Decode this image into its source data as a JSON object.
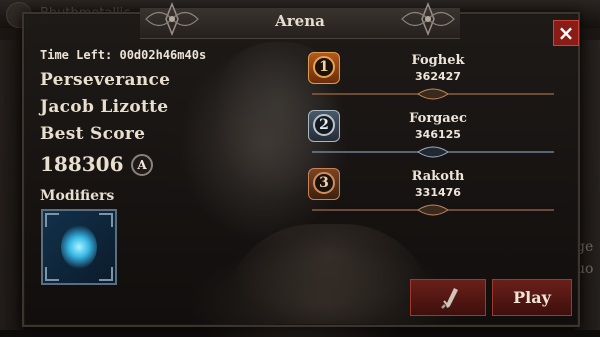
{
  "background": {
    "player_name": "Bhuthmetallic",
    "side_text": "ge\nuo"
  },
  "window": {
    "title": "Arena",
    "close_icon": "×"
  },
  "info": {
    "time_left": "Time Left: 00d02h46m40s",
    "mode": "Perseverance",
    "author": "Jacob Lizotte",
    "best_score_label": "Best Score",
    "best_score": "188306",
    "grade": "A",
    "modifiers_label": "Modifiers"
  },
  "leaderboard": [
    {
      "rank": "1",
      "name": "Foghek",
      "score": "362427",
      "tier": "gold"
    },
    {
      "rank": "2",
      "name": "Forgaec",
      "score": "346125",
      "tier": "silver"
    },
    {
      "rank": "3",
      "name": "Rakoth",
      "score": "331476",
      "tier": "bronze"
    }
  ],
  "buttons": {
    "play": "Play",
    "sword_icon": "sword-icon"
  },
  "colors": {
    "button_red": "#6a1f1a",
    "close_red": "#8a1c17",
    "text": "#e9dfcf",
    "gold": "#e5a456",
    "silver": "#b7c4d0",
    "bronze": "#d08d5e"
  }
}
